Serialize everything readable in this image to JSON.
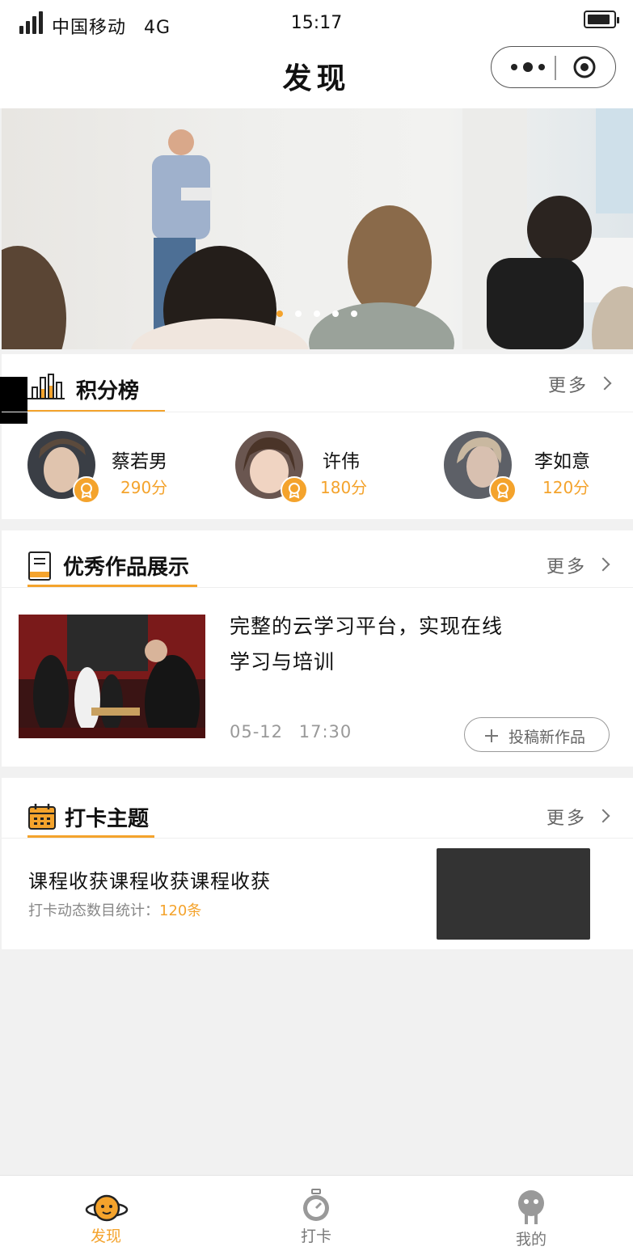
{
  "status_bar": {
    "carrier": "中国移动",
    "network": "4G",
    "time": "15:17"
  },
  "nav": {
    "title": "发现"
  },
  "banner": {
    "slide_count": 5,
    "active_slide": 1
  },
  "leaderboard": {
    "title": "积分榜",
    "more": "更多",
    "users": [
      {
        "name": "蔡若男",
        "score": "290分"
      },
      {
        "name": "许伟",
        "score": "180分"
      },
      {
        "name": "李如意",
        "score": "120分"
      }
    ]
  },
  "works": {
    "title": "优秀作品展示",
    "more": "更多",
    "post": {
      "title_line1": "完整的云学习平台，实现在线",
      "title_line2": "学习与培训",
      "date": "05-12",
      "time": "17:30",
      "submit_label": "投稿新作品"
    }
  },
  "checkin": {
    "title": "打卡主题",
    "more": "更多",
    "topic": {
      "title": "课程收获课程收获课程收获",
      "stat_label": "打卡动态数目统计：",
      "stat_value": "120条"
    }
  },
  "tabbar": {
    "items": [
      {
        "label": "发现",
        "active": true
      },
      {
        "label": "打卡",
        "active": false
      },
      {
        "label": "我的",
        "active": false
      }
    ]
  },
  "colors": {
    "accent": "#f4a32c",
    "text": "#111111",
    "muted": "#999999",
    "background": "#f1f1f1"
  }
}
